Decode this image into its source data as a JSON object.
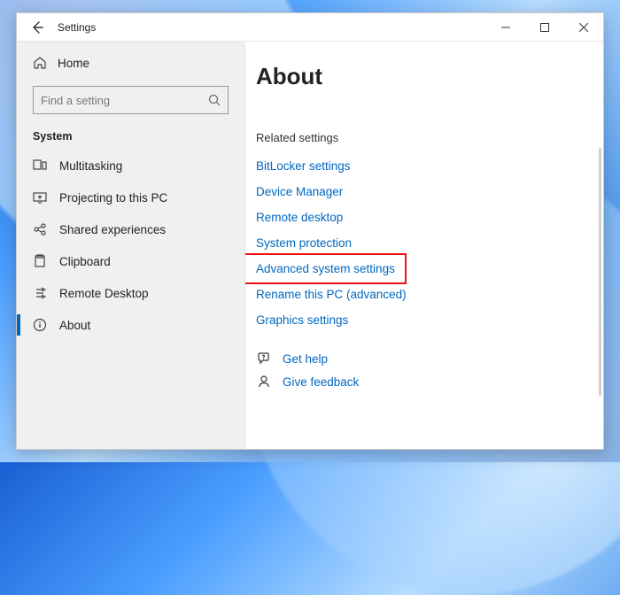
{
  "window": {
    "title": "Settings"
  },
  "sidebar": {
    "home": "Home",
    "search_placeholder": "Find a setting",
    "section": "System",
    "items": [
      {
        "icon": "multitasking-icon",
        "label": "Multitasking"
      },
      {
        "icon": "project-icon",
        "label": "Projecting to this PC"
      },
      {
        "icon": "share-icon",
        "label": "Shared experiences"
      },
      {
        "icon": "clipboard-icon",
        "label": "Clipboard"
      },
      {
        "icon": "remote-icon",
        "label": "Remote Desktop"
      },
      {
        "icon": "info-icon",
        "label": "About"
      }
    ]
  },
  "main": {
    "title": "About",
    "related_heading": "Related settings",
    "links": [
      "BitLocker settings",
      "Device Manager",
      "Remote desktop",
      "System protection",
      "Advanced system settings",
      "Rename this PC (advanced)",
      "Graphics settings"
    ],
    "help": "Get help",
    "feedback": "Give feedback"
  }
}
